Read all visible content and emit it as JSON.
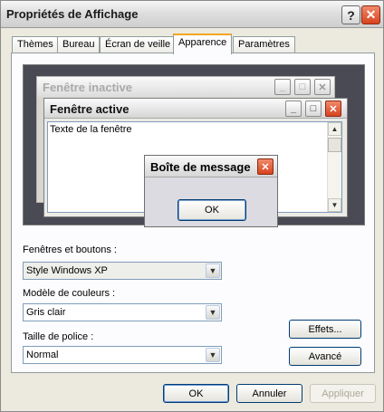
{
  "window": {
    "title": "Propriétés de Affichage",
    "help_glyph": "?",
    "close_glyph": "✕"
  },
  "tabs": [
    {
      "label": "Thèmes",
      "active": false
    },
    {
      "label": "Bureau",
      "active": false
    },
    {
      "label": "Écran de veille",
      "active": false
    },
    {
      "label": "Apparence",
      "active": true
    },
    {
      "label": "Paramètres",
      "active": false
    }
  ],
  "preview": {
    "inactive_window_title": "Fenêtre inactive",
    "active_window_title": "Fenêtre active",
    "window_text": "Texte de la fenêtre",
    "message_box_title": "Boîte de message",
    "ok_label": "OK",
    "minimize_glyph": "_",
    "maximize_glyph": "□",
    "close_glyph": "✕",
    "scroll_up_glyph": "▲",
    "scroll_down_glyph": "▼"
  },
  "form": {
    "windows_buttons_label": "Fenêtres et boutons :",
    "windows_buttons_value": "Style Windows XP",
    "color_scheme_label": "Modèle de couleurs :",
    "color_scheme_value": "Gris clair",
    "font_size_label": "Taille de police :",
    "font_size_value": "Normal",
    "dropdown_glyph": "▼"
  },
  "side_buttons": {
    "effects": "Effets...",
    "advanced": "Avancé"
  },
  "footer": {
    "ok": "OK",
    "cancel": "Annuler",
    "apply": "Appliquer"
  },
  "colors": {
    "accent_tab": "#f5a623",
    "close_red": "#d8431f",
    "preview_bg": "#4a4a55"
  }
}
